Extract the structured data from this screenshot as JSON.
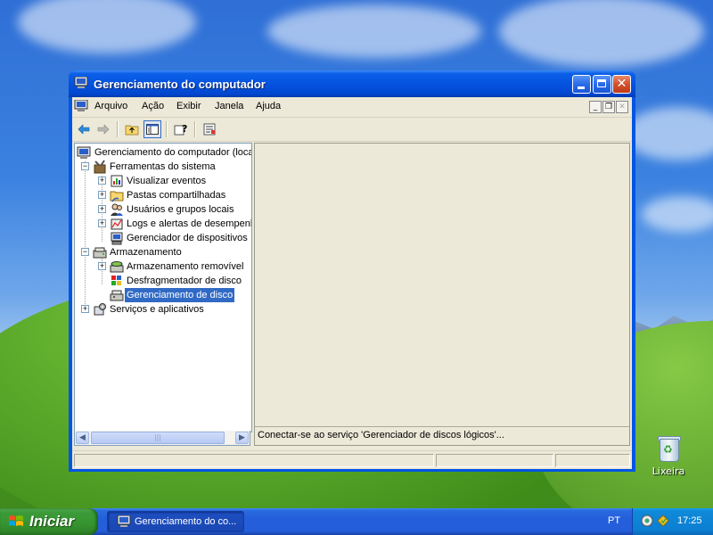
{
  "window": {
    "title": "Gerenciamento do computador"
  },
  "menubar": {
    "items": [
      "Arquivo",
      "Ação",
      "Exibir",
      "Janela",
      "Ajuda"
    ]
  },
  "toolbar": {
    "buttons": [
      "back-arrow-icon",
      "forward-arrow-icon",
      "up-folder-icon",
      "show-hide-tree-icon",
      "help-icon",
      "properties-icon"
    ]
  },
  "tree": {
    "root": "Gerenciamento do computador (local",
    "system_tools": "Ferramentas do sistema",
    "event_viewer": "Visualizar eventos",
    "shared_folders": "Pastas compartilhadas",
    "local_users": "Usuários e grupos locais",
    "perf_logs": "Logs e alertas de desempenh",
    "device_manager": "Gerenciador de dispositivos",
    "storage": "Armazenamento",
    "removable_storage": "Armazenamento removível",
    "defrag": "Desfragmentador de disco",
    "disk_management": "Gerenciamento de disco",
    "services_apps": "Serviços e aplicativos"
  },
  "detail": {
    "status_message": "Conectar-se ao serviço 'Gerenciador de discos lógicos'..."
  },
  "desktop": {
    "recycle_bin": "Lixeira"
  },
  "taskbar": {
    "start_label": "Iniciar",
    "task_label": "Gerenciamento do co...",
    "language": "PT",
    "clock": "17:25"
  },
  "colors": {
    "titlebar": "#0553e0",
    "selection": "#316ac5",
    "window_face": "#ece9d8",
    "taskbar": "#245edb",
    "start_button": "#36942f"
  }
}
